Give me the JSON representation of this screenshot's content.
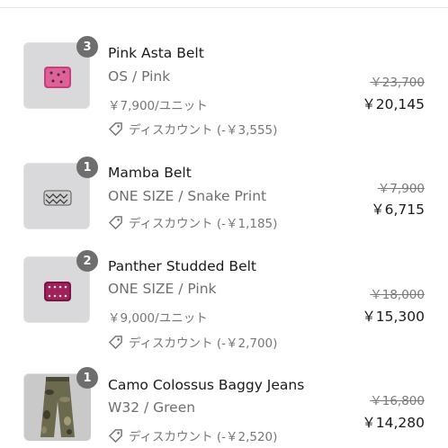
{
  "items": [
    {
      "quantity": "3",
      "name": "Pink Asta Belt",
      "variant": "OS / Pink",
      "unit_price": "￥7,900/ユニット",
      "discount": "ディスカウント (-￥3,555)",
      "original_price": "￥23,700",
      "final_price": "￥20,145",
      "image_icon": "pink-belt-image"
    },
    {
      "quantity": "1",
      "name": "Mamba Belt",
      "variant": "ONE SIZE / Snake Print",
      "discount": "ディスカウント (-￥1,185)",
      "original_price": "￥7,900",
      "final_price": "￥6,715",
      "image_icon": "snake-belt-image"
    },
    {
      "quantity": "2",
      "name": "Panther Studded Belt",
      "variant": "ONE SIZE / Pink",
      "unit_price": "￥9,000/ユニット",
      "discount": "ディスカウント (-￥2,700)",
      "original_price": "￥18,000",
      "final_price": "￥15,300",
      "image_icon": "studded-belt-image"
    },
    {
      "quantity": "1",
      "name": "Camo Colossus Baggy Jeans",
      "variant": "W32 / Green",
      "discount": "ディスカウント (-￥2,520)",
      "original_price": "￥16,800",
      "final_price": "￥14,280",
      "image_icon": "camo-jeans-image"
    }
  ],
  "colors": {
    "badge": "#6e6e6e",
    "muted_text": "#777777",
    "thumb_bg": "#d9d9dc"
  }
}
